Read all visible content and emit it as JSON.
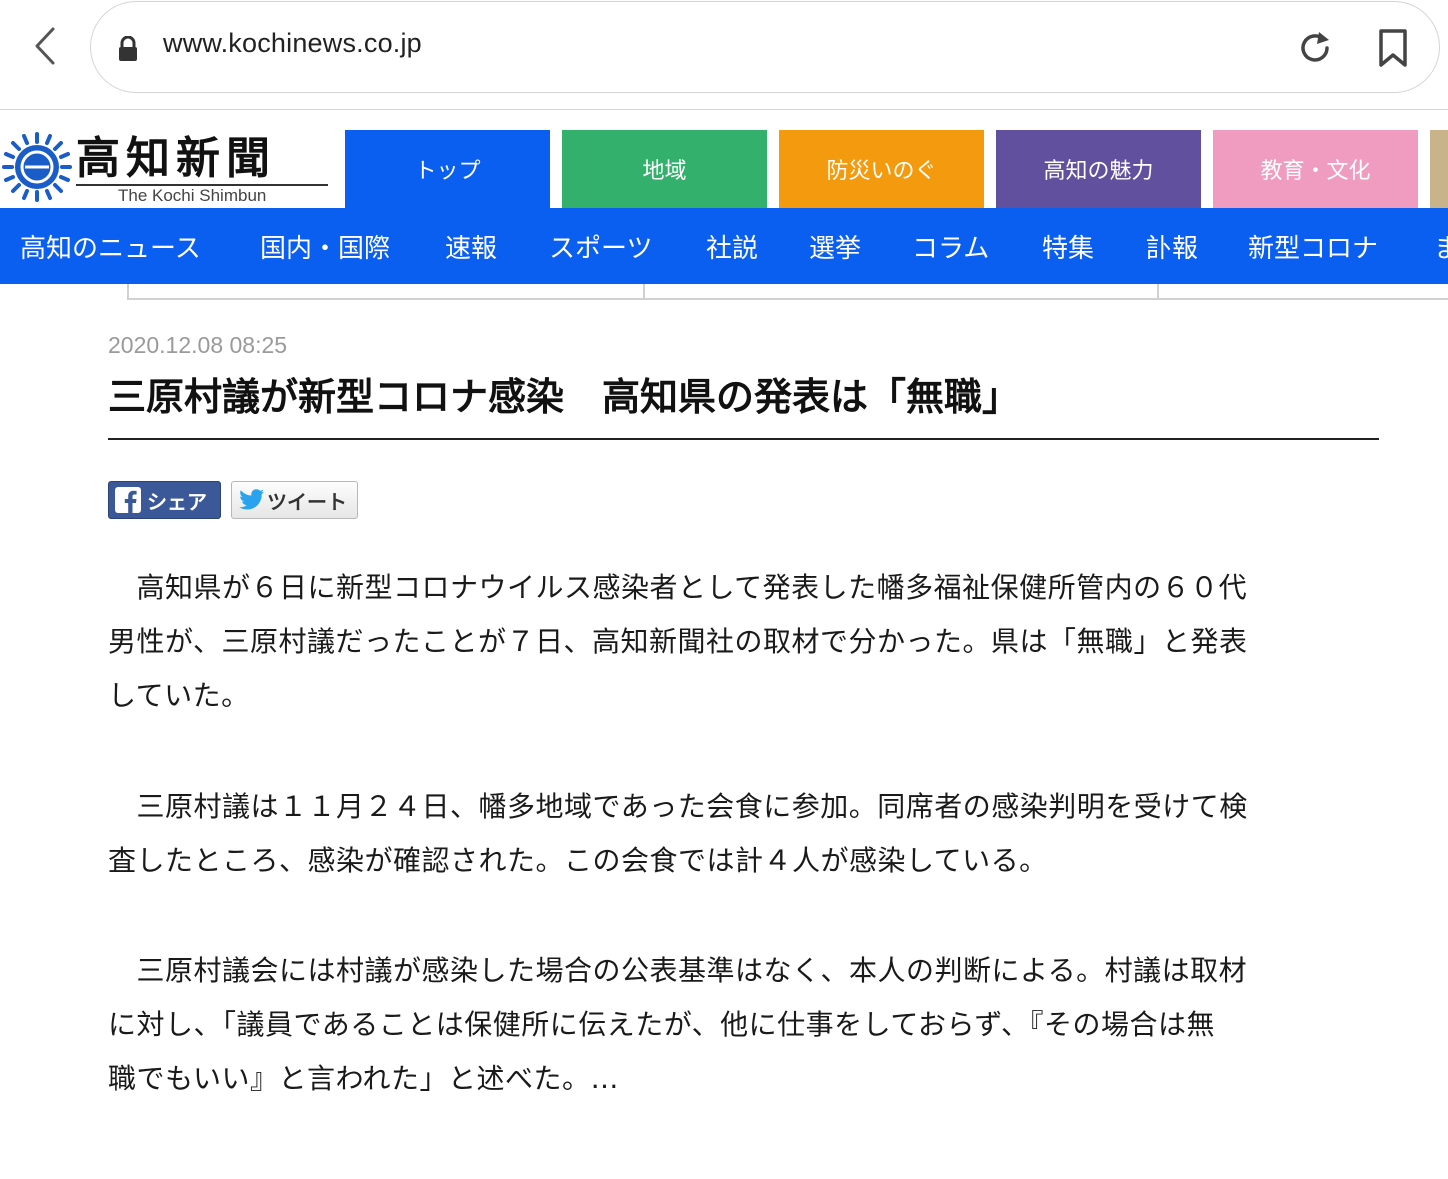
{
  "browser": {
    "url": "www.kochinews.co.jp"
  },
  "site": {
    "logo_jp": "高知新聞",
    "logo_en": "The Kochi Shimbun",
    "categories": [
      {
        "label": "トップ",
        "color": "#0a5ff0"
      },
      {
        "label": "地域",
        "color": "#33b06b"
      },
      {
        "label": "防災いのぐ",
        "color": "#f39a0e"
      },
      {
        "label": "高知の魅力",
        "color": "#60509e"
      },
      {
        "label": "教育・文化",
        "color": "#f09cc0"
      }
    ],
    "nav": [
      "高知のニュース",
      "国内・国際",
      "速報",
      "スポーツ",
      "社説",
      "選挙",
      "コラム",
      "特集",
      "訃報",
      "新型コロナ",
      "ま"
    ]
  },
  "article": {
    "date": "2020.12.08 08:25",
    "title": "三原村議が新型コロナ感染　高知県の発表は「無職」",
    "share_facebook": "シェア",
    "share_twitter": "ツイート",
    "paragraphs": [
      [
        "　高知県が６日に新型コロナウイルス感染者として発表した幡多福祉保健所管内の６０代",
        "男性が、三原村議だったことが７日、高知新聞社の取材で分かった。県は「無職」と発表",
        "していた。"
      ],
      [
        "　三原村議は１１月２４日、幡多地域であった会食に参加。同席者の感染判明を受けて検",
        "査したところ、感染が確認された。この会食では計４人が感染している。"
      ],
      [
        "　三原村議会には村議が感染した場合の公表基準はなく、本人の判断による。村議は取材",
        "に対し、「議員であることは保健所に伝えたが、他に仕事をしておらず、『その場合は無",
        "職でもいい』と言われた」と述べた。…"
      ]
    ]
  }
}
